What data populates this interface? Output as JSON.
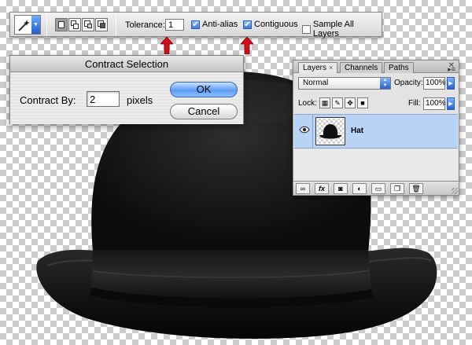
{
  "options_bar": {
    "tolerance_label": "Tolerance:",
    "tolerance_value": "1",
    "anti_alias_label": "Anti-alias",
    "anti_alias_checked": true,
    "contiguous_label": "Contiguous",
    "contiguous_checked": true,
    "sample_all_label": "Sample All Layers",
    "sample_all_checked": false,
    "tool_icon": "magic-wand-icon",
    "arrow_color": "#d0111b"
  },
  "dialog": {
    "title": "Contract Selection",
    "contract_by_label": "Contract By:",
    "contract_by_value": "2",
    "unit": "pixels",
    "ok_label": "OK",
    "cancel_label": "Cancel"
  },
  "layers_panel": {
    "tabs": [
      {
        "label": "Layers",
        "close": "×"
      },
      {
        "label": "Channels"
      },
      {
        "label": "Paths"
      }
    ],
    "blend_mode": "Normal",
    "opacity_label": "Opacity:",
    "opacity_value": "100%",
    "lock_label": "Lock:",
    "fill_label": "Fill:",
    "fill_value": "100%",
    "layer_name": "Hat",
    "selection_color": "#b9d3f6"
  }
}
